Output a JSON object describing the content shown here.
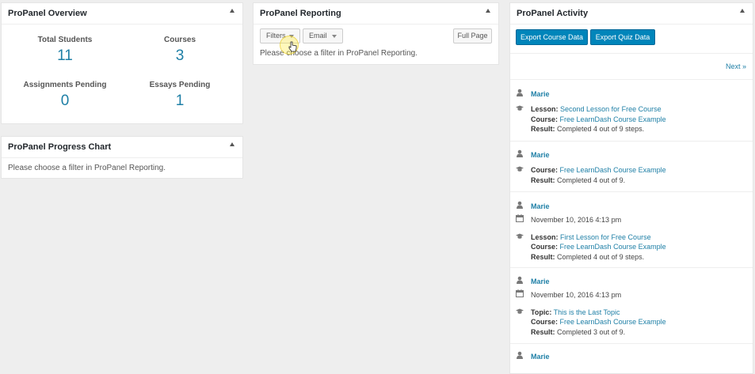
{
  "overview": {
    "title": "ProPanel Overview",
    "stats": [
      {
        "label": "Total Students",
        "value": "11"
      },
      {
        "label": "Courses",
        "value": "3"
      },
      {
        "label": "Assignments Pending",
        "value": "0"
      },
      {
        "label": "Essays Pending",
        "value": "1"
      }
    ]
  },
  "progress": {
    "title": "ProPanel Progress Chart",
    "message": "Please choose a filter in ProPanel Reporting."
  },
  "reporting": {
    "title": "ProPanel Reporting",
    "filters_label": "Filters",
    "email_label": "Email",
    "full_page_label": "Full Page",
    "message": "Please choose a filter in ProPanel Reporting."
  },
  "activity": {
    "title": "ProPanel Activity",
    "export_course_label": "Export Course Data",
    "export_quiz_label": "Export Quiz Data",
    "next_label": "Next »",
    "labels": {
      "lesson": "Lesson:",
      "course": "Course:",
      "topic": "Topic:",
      "result": "Result:"
    },
    "entries": [
      {
        "user": "Marie",
        "lesson": "Second Lesson for Free Course",
        "course": "Free LearnDash Course Example",
        "result": "Completed 4 out of 9 steps."
      },
      {
        "user": "Marie",
        "course": "Free LearnDash Course Example",
        "result": "Completed 4 out of 9."
      },
      {
        "user": "Marie",
        "date": "November 10, 2016 4:13 pm",
        "lesson": "First Lesson for Free Course",
        "course": "Free LearnDash Course Example",
        "result": "Completed 4 out of 9 steps."
      },
      {
        "user": "Marie",
        "date": "November 10, 2016 4:13 pm",
        "topic": "This is the Last Topic",
        "course": "Free LearnDash Course Example",
        "result": "Completed 3 out of 9."
      },
      {
        "user": "Marie"
      }
    ]
  }
}
